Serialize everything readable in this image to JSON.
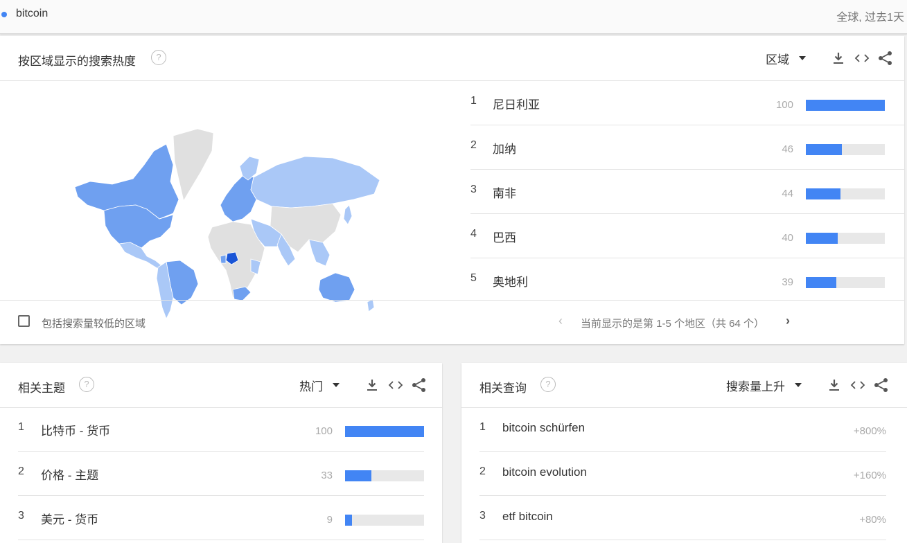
{
  "search": {
    "term": "bitcoin",
    "scope": "全球, 过去1天"
  },
  "region_card": {
    "title": "按区域显示的搜索热度",
    "help": "?",
    "resolution_label": "区域",
    "rows": [
      {
        "rank": "1",
        "name": "尼日利亚",
        "value": "100",
        "fraction": 1.0
      },
      {
        "rank": "2",
        "name": "加纳",
        "value": "46",
        "fraction": 0.46
      },
      {
        "rank": "3",
        "name": "南非",
        "value": "44",
        "fraction": 0.44
      },
      {
        "rank": "4",
        "name": "巴西",
        "value": "40",
        "fraction": 0.4
      },
      {
        "rank": "5",
        "name": "奥地利",
        "value": "39",
        "fraction": 0.39
      }
    ],
    "include_low_volume_label": "包括搜索量较低的区域",
    "pager_text": "当前显示的是第 1-5 个地区（共 64 个）",
    "pager_prev": "‹",
    "pager_next": "›"
  },
  "topics_card": {
    "title": "相关主题",
    "help": "?",
    "filter_label": "热门",
    "rows": [
      {
        "rank": "1",
        "name": "比特币 - 货币",
        "value": "100",
        "fraction": 1.0
      },
      {
        "rank": "2",
        "name": "价格 - 主题",
        "value": "33",
        "fraction": 0.33
      },
      {
        "rank": "3",
        "name": "美元 - 货币",
        "value": "9",
        "fraction": 0.09
      }
    ]
  },
  "queries_card": {
    "title": "相关查询",
    "help": "?",
    "filter_label": "搜索量上升",
    "rows": [
      {
        "rank": "1",
        "name": "bitcoin schürfen",
        "value": "+800%"
      },
      {
        "rank": "2",
        "name": "bitcoin evolution",
        "value": "+160%"
      },
      {
        "rank": "3",
        "name": "etf bitcoin",
        "value": "+80%"
      }
    ]
  },
  "colors": {
    "accent": "#4285f4",
    "map_high": "#1a55d6",
    "map_mid": "#6fa0f0",
    "map_low": "#aac8f7",
    "map_none": "#e0e0e0"
  },
  "icons": [
    "download-icon",
    "embed-icon",
    "share-icon",
    "help-icon",
    "chevron-down-icon"
  ]
}
